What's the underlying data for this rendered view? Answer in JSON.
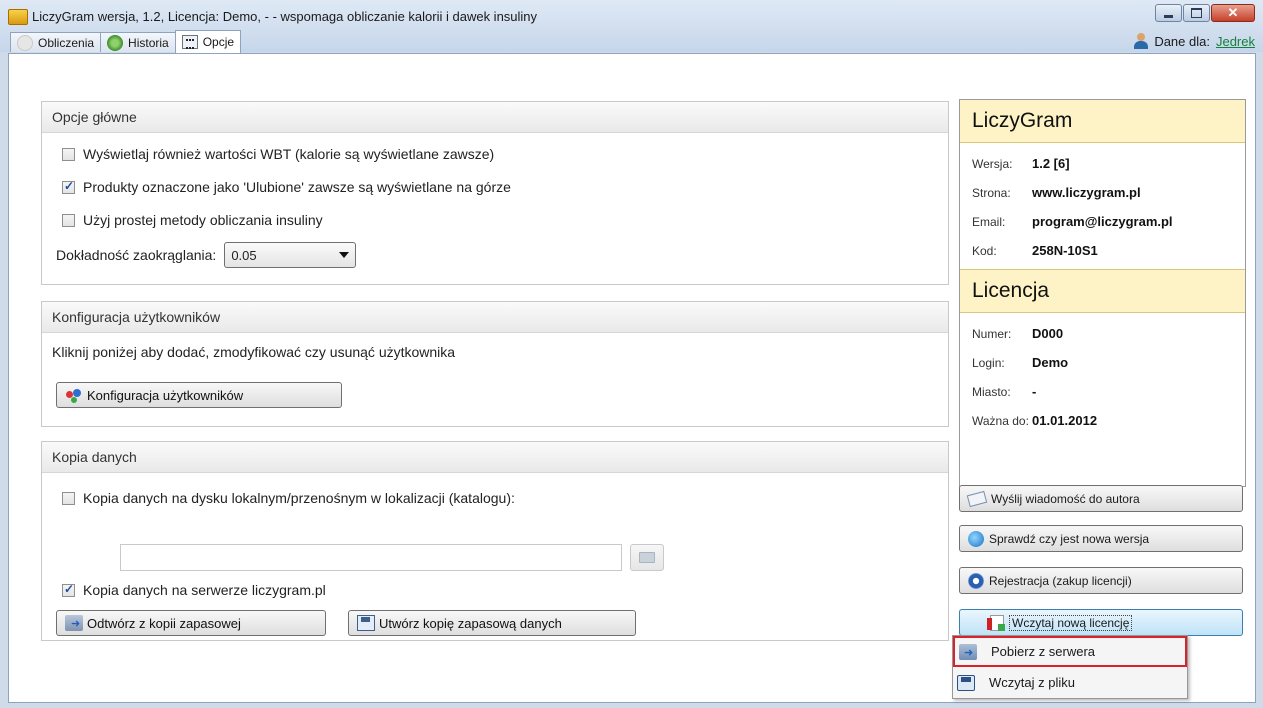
{
  "window": {
    "title": "LiczyGram wersja, 1.2, Licencja: Demo, - - wspomaga obliczanie kalorii i dawek insuliny",
    "minimize": "–",
    "maximize": "□",
    "close": "✕"
  },
  "tabs": [
    {
      "label": "Obliczenia"
    },
    {
      "label": "Historia"
    },
    {
      "label": "Opcje"
    }
  ],
  "user": {
    "label": "Dane dla:",
    "name": "Jedrek"
  },
  "main_options": {
    "title": "Opcje główne",
    "opt_wbt": {
      "label": "Wyświetlaj również wartości WBT (kalorie są wyświetlane zawsze)",
      "checked": false
    },
    "opt_fav": {
      "label": "Produkty oznaczone jako 'Ulubione' zawsze są wyświetlane na górze",
      "checked": true
    },
    "opt_simple": {
      "label": "Użyj prostej metody obliczania insuliny",
      "checked": false
    },
    "rounding_label": "Dokładność zaokrąglania:",
    "rounding_value": "0.05"
  },
  "users_config": {
    "title": "Konfiguracja użytkowników",
    "desc": "Kliknij poniżej aby dodać, zmodyfikować czy usunąć użytkownika",
    "button": "Konfiguracja użytkowników"
  },
  "backup": {
    "title": "Kopia danych",
    "local_label": "Kopia danych na dysku lokalnym/przenośnym w lokalizacji (katalogu):",
    "local_checked": false,
    "path_value": "",
    "server_label": "Kopia danych na serwerze liczygram.pl",
    "server_checked": true,
    "restore_button": "Odtwórz z kopii zapasowej",
    "create_button": "Utwórz kopię zapasową danych"
  },
  "info": {
    "app_title": "LiczyGram",
    "version_key": "Wersja:",
    "version_val": "1.2 [6]",
    "site_key": "Strona:",
    "site_val": "www.liczygram.pl",
    "email_key": "Email:",
    "email_val": "program@liczygram.pl",
    "code_key": "Kod:",
    "code_val": "258N-10S1",
    "license_title": "Licencja",
    "number_key": "Numer:",
    "number_val": "D000",
    "login_key": "Login:",
    "login_val": "Demo",
    "city_key": "Miasto:",
    "city_val": "-",
    "valid_key": "Ważna do:",
    "valid_val": "01.01.2012"
  },
  "actions": {
    "send_msg": "Wyślij wiadomość do autora",
    "check_version": "Sprawdź czy jest nowa wersja",
    "register": "Rejestracja (zakup licencji)",
    "load_license": "Wczytaj nową licencję"
  },
  "dropdown": {
    "from_server": "Pobierz z serwera",
    "from_file": "Wczytaj z pliku"
  },
  "icons": [
    "app-icon",
    "calculator-icon",
    "history-icon",
    "options-icon",
    "user-icon",
    "users-config-icon",
    "restore-icon",
    "save-icon",
    "folder-icon",
    "mail-icon",
    "globe-icon",
    "registration-icon",
    "license-icon",
    "download-icon",
    "floppy-icon"
  ],
  "colors": {
    "info_header_bg": "#fdf3c6",
    "user_link": "#15803a",
    "highlight_border": "#d9232a"
  }
}
